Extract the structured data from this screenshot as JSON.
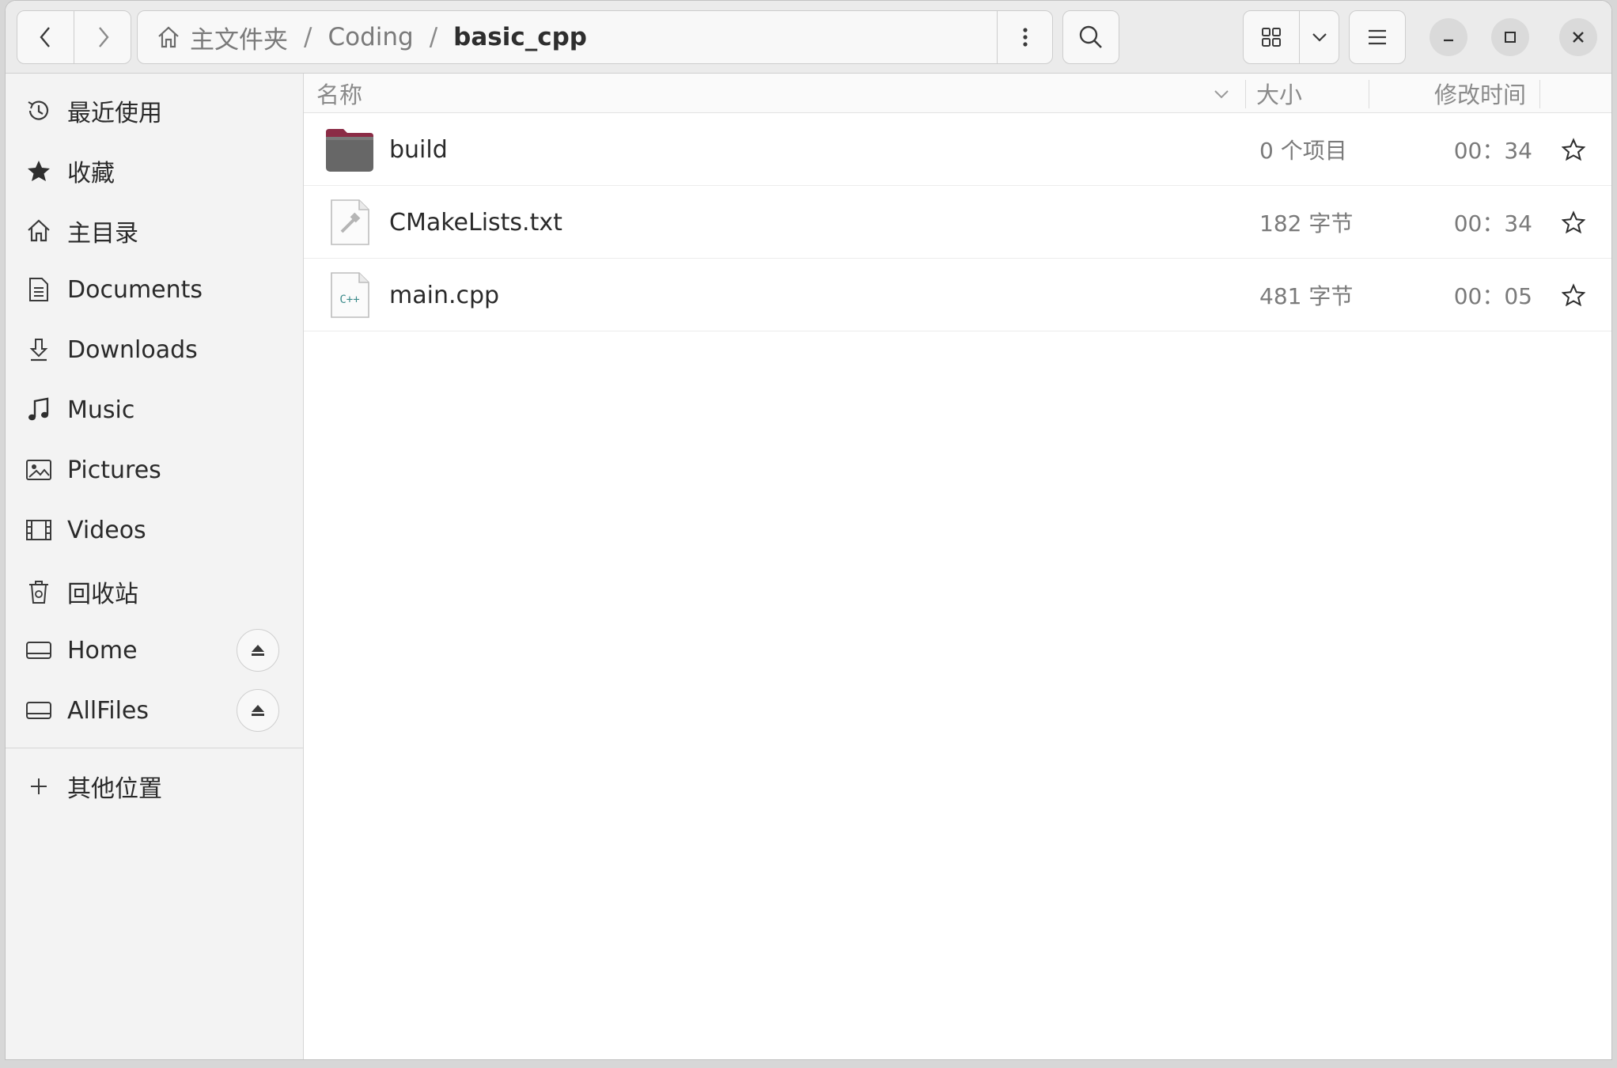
{
  "header": {
    "back_icon": "chevron-left-icon",
    "forward_icon": "chevron-right-icon",
    "breadcrumb": [
      {
        "label": "主文件夹",
        "icon": "home-icon"
      },
      {
        "label": "Coding"
      },
      {
        "label": "basic_cpp",
        "current": true
      }
    ],
    "separator": "/",
    "path_menu_icon": "vertical-dots-icon",
    "search_icon": "search-icon",
    "view_icon": "grid-view-icon",
    "view_dropdown_icon": "chevron-down-icon",
    "menu_icon": "hamburger-menu-icon",
    "window_controls": [
      "minimize-icon",
      "maximize-icon",
      "close-icon"
    ]
  },
  "sidebar": {
    "items": [
      {
        "label": "最近使用",
        "icon": "clock-icon"
      },
      {
        "label": "收藏",
        "icon": "star-filled-icon"
      },
      {
        "label": "主目录",
        "icon": "home-icon"
      },
      {
        "label": "Documents",
        "icon": "document-icon"
      },
      {
        "label": "Downloads",
        "icon": "download-icon"
      },
      {
        "label": "Music",
        "icon": "music-note-icon"
      },
      {
        "label": "Pictures",
        "icon": "picture-icon"
      },
      {
        "label": "Videos",
        "icon": "film-icon"
      },
      {
        "label": "回收站",
        "icon": "trash-icon"
      },
      {
        "label": "Home",
        "icon": "drive-icon",
        "eject": true
      },
      {
        "label": "AllFiles",
        "icon": "drive-icon",
        "eject": true
      }
    ],
    "other_locations": {
      "label": "其他位置",
      "icon": "plus-icon"
    }
  },
  "file_list": {
    "columns": {
      "name": "名称",
      "size": "大小",
      "modified": "修改时间"
    },
    "sort_icon": "chevron-down-icon",
    "files": [
      {
        "name": "build",
        "size": "0 个项目",
        "modified": "00：34",
        "icon": "folder-icon"
      },
      {
        "name": "CMakeLists.txt",
        "size": "182 字节",
        "modified": "00：34",
        "icon": "cmake-file-icon"
      },
      {
        "name": "main.cpp",
        "size": "481 字节",
        "modified": "00：05",
        "icon": "cpp-file-icon"
      }
    ]
  },
  "colors": {
    "accent_folder": "#8b2c46",
    "folder_body": "#6a6a6a",
    "cpp_text": "#3c8b8b"
  }
}
